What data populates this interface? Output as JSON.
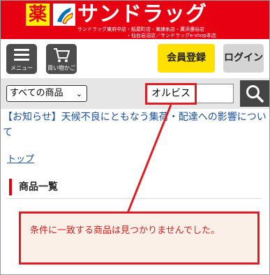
{
  "header": {
    "logo_kanji": "薬",
    "logo_text": "サンドラッグ",
    "store_line1": "サンドラッグ東府中店・船屋町店・東練糸店・廣浜遷谷店",
    "store_line2": "・仙台岩沼店／サンドラッグe-shop本店"
  },
  "nav": {
    "menu_label": "メニュー",
    "cart_label": "買い物かご",
    "register_label": "会員登録",
    "login_label": "ログイン"
  },
  "search": {
    "category_value": "すべての商品",
    "query": "オルビス"
  },
  "notice": {
    "text": "【お知らせ】天候不良にともなう集荷・配達への影響について"
  },
  "breadcrumb": {
    "home": "トップ"
  },
  "section": {
    "title": "商品一覧"
  },
  "result": {
    "message": "条件に一致する商品は見つかりませんでした。"
  },
  "colors": {
    "brand_red": "#e60012",
    "accent_yellow": "#ffe000",
    "highlight_red": "#e01c24"
  }
}
